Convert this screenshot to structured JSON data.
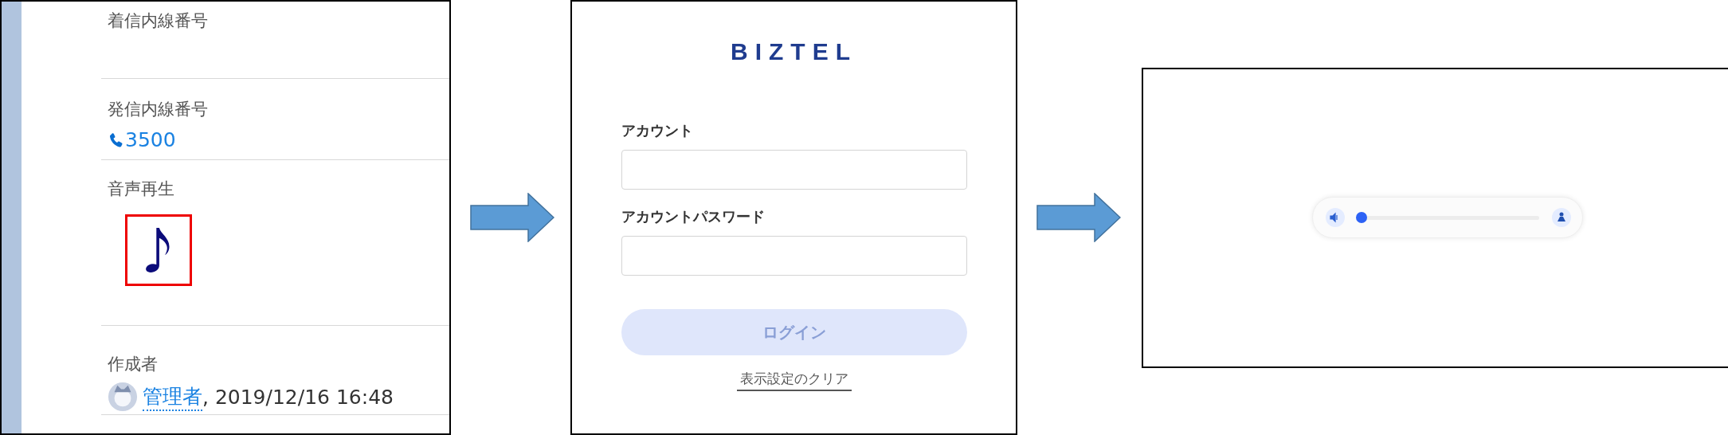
{
  "record_panel": {
    "fields": [
      {
        "kind": "empty",
        "label": "着信内線番号"
      },
      {
        "kind": "phone",
        "label": "発信内線番号",
        "value": "3500"
      },
      {
        "kind": "audio",
        "label": "音声再生"
      },
      {
        "kind": "creator",
        "label": "作成者",
        "user": "管理者",
        "timestamp": ", 2019/12/16 16:48"
      }
    ]
  },
  "login_panel": {
    "logo": "BIZTEL",
    "fields": [
      {
        "label": "アカウント"
      },
      {
        "label": "アカウントパスワード"
      }
    ],
    "login_button": {
      "label": "ログイン",
      "disabled": true
    },
    "clear_link": "表示設定のクリア"
  },
  "player_panel": {
    "player": {
      "level": 0
    }
  }
}
